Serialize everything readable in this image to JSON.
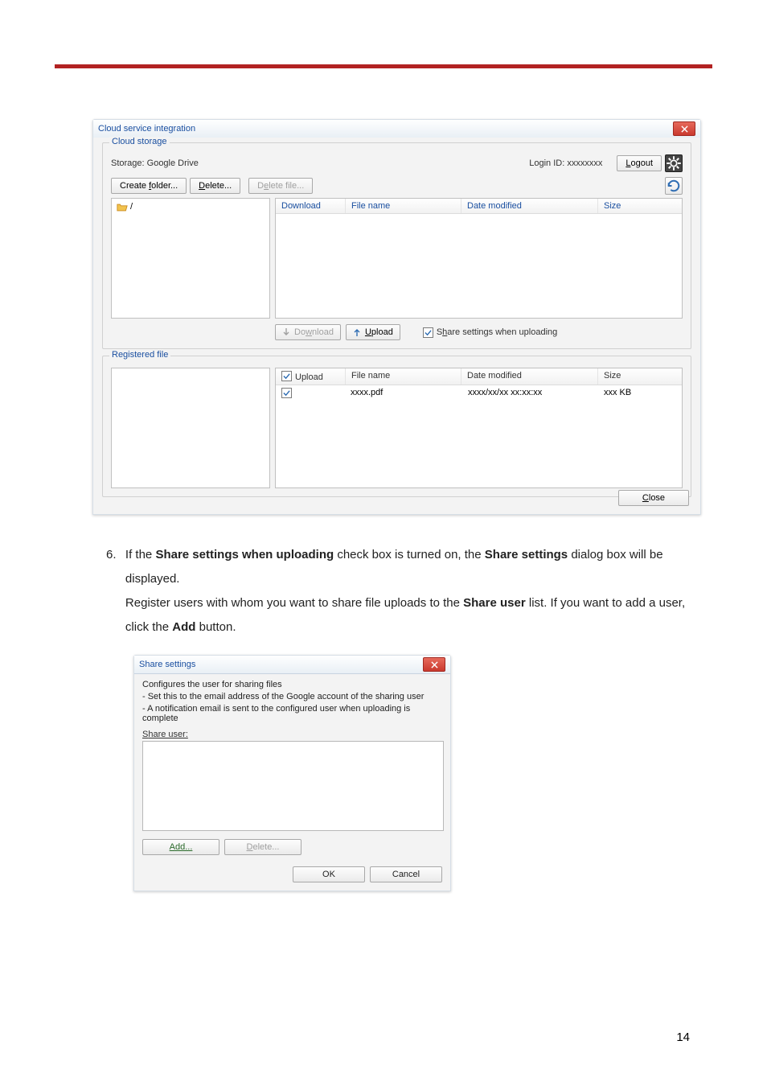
{
  "page_number": "14",
  "step_number": "6.",
  "body": {
    "line1a": "If the ",
    "line1b": "Share settings when uploading",
    "line1c": " check box is turned on, the ",
    "line1d": "Share settings",
    "line1e": " dialog box will be displayed.",
    "line2a": "Register users with whom you want to share file uploads to the ",
    "line2b": "Share user",
    "line2c": " list. If you want to add a user, click the ",
    "line2d": "Add",
    "line2e": " button."
  },
  "main_dialog": {
    "title": "Cloud service integration",
    "group_cloud": "Cloud storage",
    "group_registered": "Registered file",
    "storage_label": "Storage: Google Drive",
    "login_id": "Login ID: xxxxxxxx",
    "logout_pre": "L",
    "logout_rest": "ogout",
    "create_folder_pre": "Create ",
    "create_folder_u": "f",
    "create_folder_post": "older...",
    "delete_u": "D",
    "delete_rest": "elete...",
    "delete_file_pre": "D",
    "delete_file_u": "e",
    "delete_file_post": "lete file...",
    "tree_root": "/",
    "cloud_cols": {
      "download": "Download",
      "name": "File name",
      "date": "Date modified",
      "size": "Size"
    },
    "download_btn_pre": "Do",
    "download_btn_u": "w",
    "download_btn_post": "nload",
    "upload_btn_u": "U",
    "upload_btn_rest": "pload",
    "share_check_pre": "S",
    "share_check_u": "h",
    "share_check_post": "are settings when uploading",
    "reg_cols": {
      "upload": "Upload",
      "name": "File name",
      "date": "Date modified",
      "size": "Size"
    },
    "reg_rows": [
      {
        "name": "xxxx.pdf",
        "date": "xxxx/xx/xx xx:xx:xx",
        "size": "xxx KB"
      }
    ],
    "close_u": "C",
    "close_rest": "lose"
  },
  "share_dialog": {
    "title": "Share settings",
    "heading": "Configures the user for sharing files",
    "line1": "- Set this to the email address of the Google account of the sharing user",
    "line2": "- A notification email is sent to the configured user when uploading is complete",
    "share_user_u": "S",
    "share_user_rest": "hare user:",
    "add_u": "A",
    "add_rest": "dd...",
    "delete_u": "D",
    "delete_rest": "elete...",
    "ok": "OK",
    "cancel": "Cancel"
  }
}
